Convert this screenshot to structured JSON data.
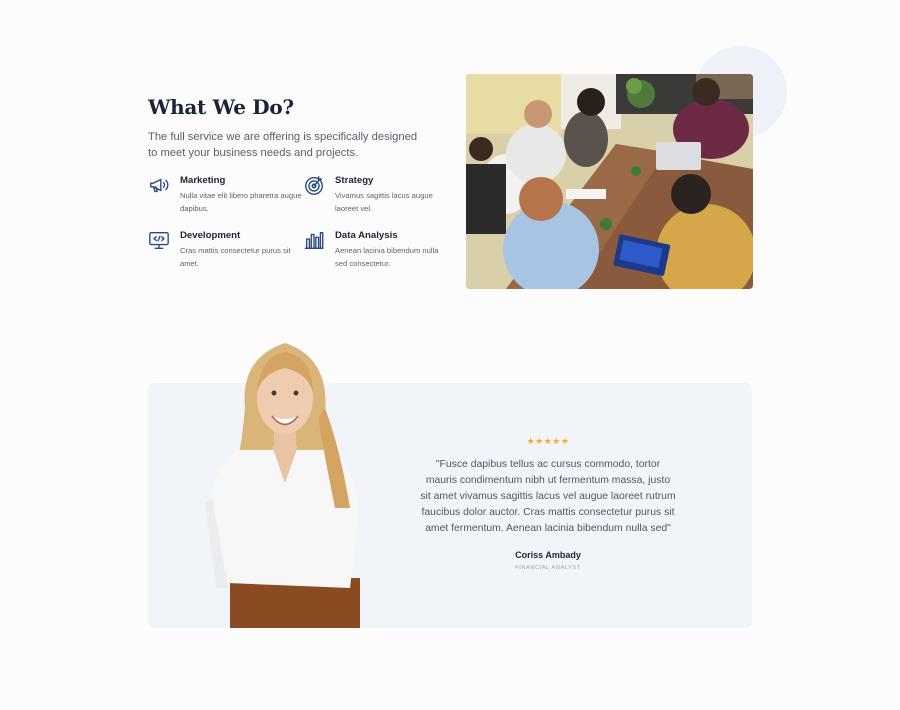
{
  "about": {
    "title": "What We Do?",
    "intro": "The full service we are offering is specifically designed to meet your business needs and projects."
  },
  "features": [
    {
      "title": "Marketing",
      "desc": "Nulla vitae elit libero pharetra augue dapibus.",
      "icon": "megaphone-icon"
    },
    {
      "title": "Strategy",
      "desc": "Vivamus sagittis lacus augue laoreet vel.",
      "icon": "target-icon"
    },
    {
      "title": "Development",
      "desc": "Cras mattis consectetur purus sit amet.",
      "icon": "monitor-code-icon"
    },
    {
      "title": "Data Analysis",
      "desc": "Aenean lacinia bibendum nulla sed consectetur.",
      "icon": "bar-chart-icon"
    }
  ],
  "testimonial": {
    "stars": "★★★★★",
    "rating": 5,
    "quote": "\"Fusce dapibus tellus ac cursus commodo, tortor mauris condimentum nibh ut fermentum massa, justo sit amet vivamus sagittis lacus vel augue laoreet rutrum faucibus dolor auctor. Cras mattis consectetur purus sit amet fermentum. Aenean lacinia bibendum nulla sed\"",
    "author": "Coriss Ambady",
    "role": "FINANCIAL ANALYST"
  },
  "colors": {
    "heading": "#1b2436",
    "icon": "#2a4a7f",
    "star": "#f2b01e",
    "testimonial_bg": "#f1f5f9",
    "accent_circle": "#eef2f8"
  }
}
